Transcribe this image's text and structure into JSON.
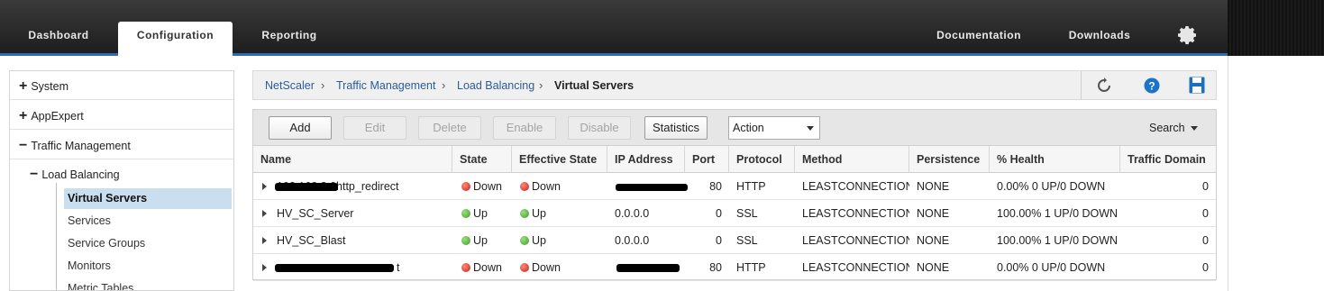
{
  "nav": {
    "tabs": [
      "Dashboard",
      "Configuration",
      "Reporting"
    ],
    "right_links": [
      "Documentation",
      "Downloads"
    ],
    "settings_icon": "gear-icon"
  },
  "sidebar": {
    "items": [
      {
        "label": "System",
        "expander": "+"
      },
      {
        "label": "AppExpert",
        "expander": "+"
      },
      {
        "label": "Traffic Management",
        "expander": "−"
      }
    ],
    "sub": {
      "label": "Load Balancing",
      "expander": "−"
    },
    "leaves": [
      "Virtual Servers",
      "Services",
      "Service Groups",
      "Monitors",
      "Metric Tables"
    ]
  },
  "breadcrumb": {
    "items": [
      "NetScaler",
      "Traffic Management",
      "Load Balancing"
    ],
    "current": "Virtual Servers",
    "icons": [
      "refresh-icon",
      "help-icon",
      "save-icon"
    ]
  },
  "toolbar": {
    "buttons": [
      {
        "label": "Add",
        "enabled": true
      },
      {
        "label": "Edit",
        "enabled": false
      },
      {
        "label": "Delete",
        "enabled": false
      },
      {
        "label": "Enable",
        "enabled": false
      },
      {
        "label": "Disable",
        "enabled": false
      },
      {
        "label": "Statistics",
        "enabled": true
      }
    ],
    "action_select": "Action",
    "search_label": "Search"
  },
  "table": {
    "columns": [
      "Name",
      "State",
      "Effective State",
      "IP Address",
      "Port",
      "Protocol",
      "Method",
      "Persistence",
      "% Health",
      "Traffic Domain"
    ],
    "rows": [
      {
        "name": "192.168.2.0http_redirect",
        "state": "Down",
        "effective_state": "Down",
        "ip": "",
        "port": "80",
        "protocol": "HTTP",
        "method": "LEASTCONNECTION",
        "persistence": "NONE",
        "health": "0.00% 0 UP/0 DOWN",
        "traffic_domain": "0"
      },
      {
        "name": "HV_SC_Server",
        "state": "Up",
        "effective_state": "Up",
        "ip": "0.0.0.0",
        "port": "0",
        "protocol": "SSL",
        "method": "LEASTCONNECTION",
        "persistence": "NONE",
        "health": "100.00% 1 UP/0 DOWN",
        "traffic_domain": "0"
      },
      {
        "name": "HV_SC_Blast",
        "state": "Up",
        "effective_state": "Up",
        "ip": "0.0.0.0",
        "port": "0",
        "protocol": "SSL",
        "method": "LEASTCONNECTION",
        "persistence": "NONE",
        "health": "100.00% 1 UP/0 DOWN",
        "traffic_domain": "0"
      },
      {
        "name": "t",
        "state": "Down",
        "effective_state": "Down",
        "ip": "",
        "port": "80",
        "protocol": "HTTP",
        "method": "LEASTCONNECTION",
        "persistence": "NONE",
        "health": "0.00% 0 UP/0 DOWN",
        "traffic_domain": "0"
      }
    ]
  },
  "colors": {
    "accent": "#2f6bb3",
    "link": "#2a5d9a",
    "selected": "#c9dff0",
    "up": "#3d9a2a",
    "down": "#c0231a"
  }
}
